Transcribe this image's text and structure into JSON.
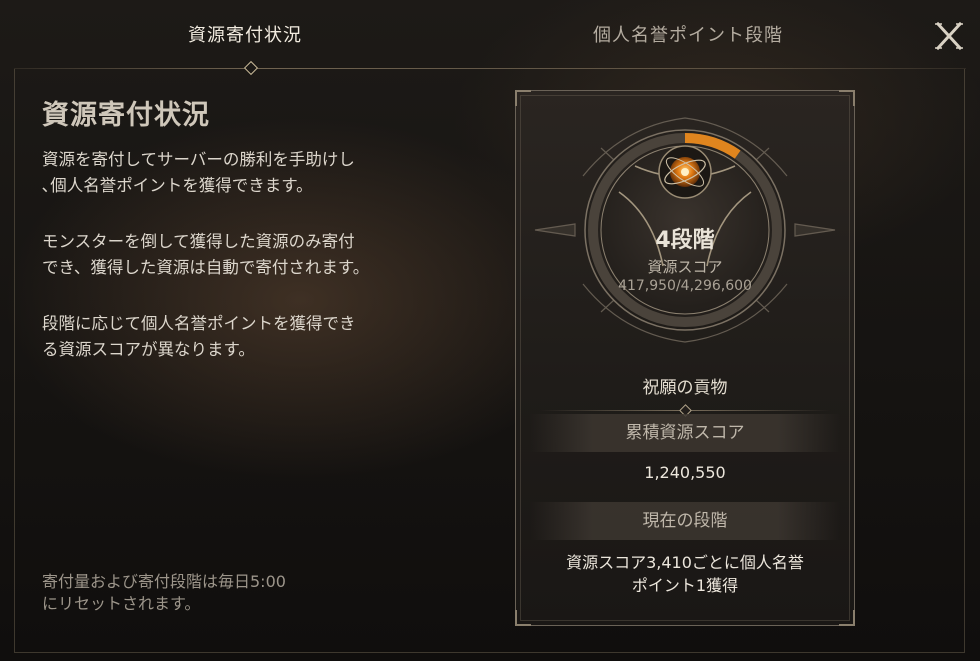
{
  "tabs": [
    {
      "label": "資源寄付状況",
      "active": true
    },
    {
      "label": "個人名誉ポイント段階",
      "active": false
    }
  ],
  "close_label": "X",
  "left_panel": {
    "title": "資源寄付状況",
    "paragraphs": [
      "資源を寄付してサーバーの勝利を手助けし\n､個人名誉ポイントを獲得できます。",
      "モンスターを倒して獲得した資源のみ寄付\nでき、獲得した資源は自動で寄付されます。",
      "段階に応じて個人名誉ポイントを獲得でき\nる資源スコアが異なります。"
    ],
    "reset_note": "寄付量および寄付段階は毎日5:00\nにリセットされます。"
  },
  "card": {
    "stage": "4段階",
    "score_label": "資源スコア",
    "score_value": "417,950/4,296,600",
    "progress": 0.097,
    "offering_title": "祝願の貢物",
    "cumulative_label": "累積資源スコア",
    "cumulative_value": "1,240,550",
    "current_stage_label": "現在の段階",
    "current_stage_reward": "資源スコア3,410ごとに個人名誉\nポイント1獲得"
  },
  "colors": {
    "accent_orange": "#e8891c",
    "text_primary": "#ece6dc",
    "text_muted": "#9c958a"
  },
  "icons": [
    "close-icon",
    "resource-orb-icon"
  ]
}
